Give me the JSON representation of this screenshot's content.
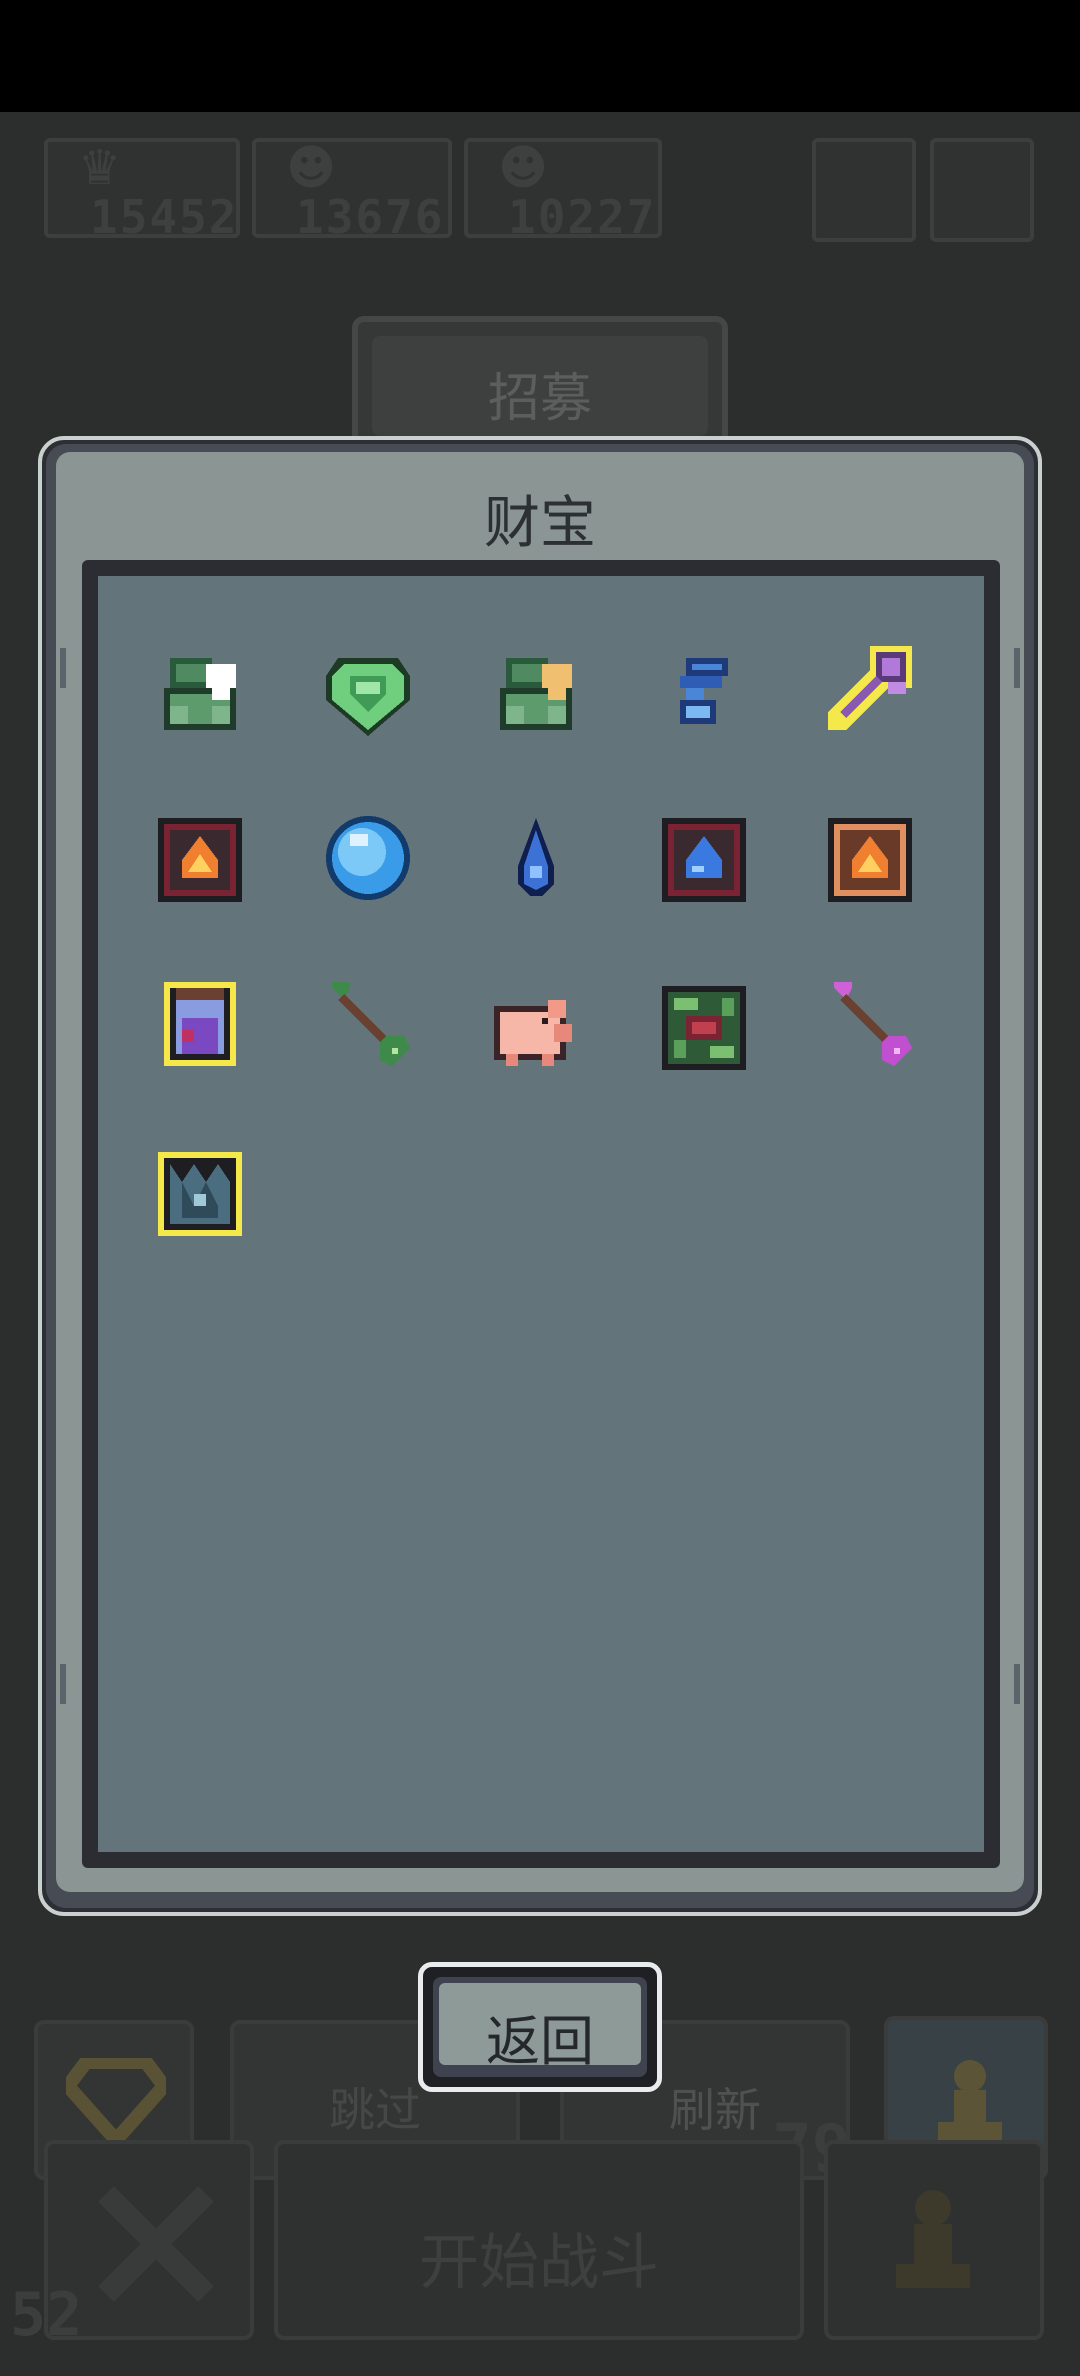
{
  "hud": {
    "resources": [
      {
        "icon": "crown-skull-icon",
        "value": "15452"
      },
      {
        "icon": "cat-face-icon",
        "value": "13676"
      },
      {
        "icon": "frog-face-icon",
        "value": "10227"
      }
    ],
    "buttons": [
      "menu-icon",
      "settings-icon"
    ]
  },
  "recruit_tab": {
    "label": "招募"
  },
  "dialog": {
    "title": "财宝",
    "items": [
      {
        "name": "green-armor-white-skull-icon",
        "rarity": "normal"
      },
      {
        "name": "green-gem-shield-icon",
        "rarity": "normal"
      },
      {
        "name": "green-armor-gold-skull-icon",
        "rarity": "normal"
      },
      {
        "name": "blue-mushroom-icon",
        "rarity": "normal"
      },
      {
        "name": "purple-scepter-icon",
        "rarity": "legendary"
      },
      {
        "name": "fire-card-red-icon",
        "rarity": "normal"
      },
      {
        "name": "blue-orb-icon",
        "rarity": "normal"
      },
      {
        "name": "water-drop-icon",
        "rarity": "normal"
      },
      {
        "name": "water-card-red-icon",
        "rarity": "normal"
      },
      {
        "name": "fire-card-orange-icon",
        "rarity": "normal"
      },
      {
        "name": "potion-jar-icon",
        "rarity": "legendary"
      },
      {
        "name": "green-arrow-icon",
        "rarity": "normal"
      },
      {
        "name": "pink-pig-icon",
        "rarity": "normal"
      },
      {
        "name": "rune-tile-icon",
        "rarity": "normal"
      },
      {
        "name": "pink-arrow-icon",
        "rarity": "normal"
      },
      {
        "name": "ice-crystal-icon",
        "rarity": "legendary"
      }
    ],
    "back_label": "返回"
  },
  "bottom": {
    "skip_label": "跳过",
    "refresh_label": "刷新",
    "refresh_count": "79",
    "start_label": "开始战斗",
    "level": "52"
  },
  "colors": {
    "legendary_outline": "#f5e84a",
    "panel_face": "#8a9594",
    "grid_bg": "#63747b"
  }
}
